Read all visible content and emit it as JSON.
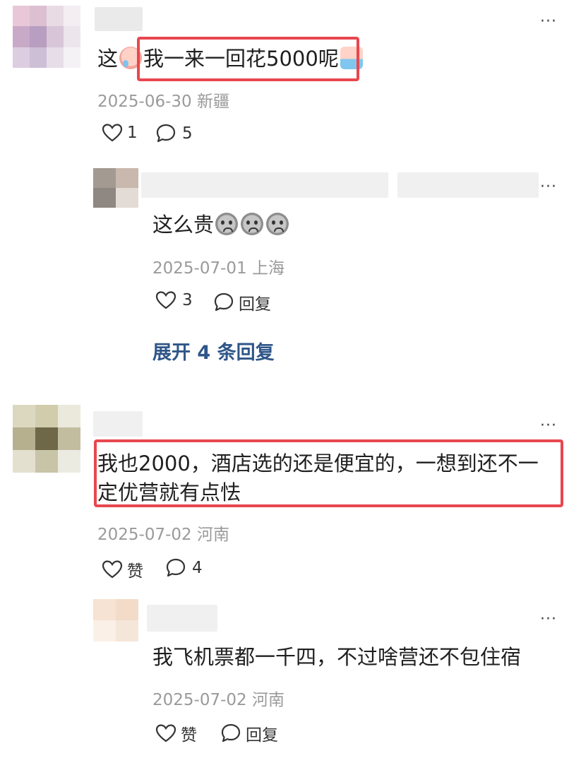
{
  "comments": [
    {
      "text_prefix": "这",
      "text_highlight": "我一来一回花5000呢",
      "meta": "2025-06-30 新疆",
      "like_count": "1",
      "reply_count": "5",
      "replies": [
        {
          "text": "这么贵",
          "meta": "2025-07-01 上海",
          "like_count": "3",
          "reply_label": "回复"
        }
      ],
      "expand_label": "展开 4 条回复"
    },
    {
      "text_line1": "我也2000，酒店选的还是便宜的，一想到还不一",
      "text_line2": "定优营就有点怯",
      "meta": "2025-07-02 河南",
      "like_label": "赞",
      "reply_count": "4",
      "replies": [
        {
          "text": "我飞机票都一千四，不过啥营还不包住宿",
          "meta": "2025-07-02 河南",
          "like_label": "赞",
          "reply_label": "回复"
        }
      ]
    }
  ],
  "more_icon": "···",
  "icons": {
    "like": "heart-outline-icon",
    "comment": "speech-bubble-icon",
    "more": "ellipsis-icon"
  },
  "colors": {
    "highlight_border": "#e8474f",
    "expand_link": "#2f5688",
    "meta_text": "#9a9a9a"
  }
}
